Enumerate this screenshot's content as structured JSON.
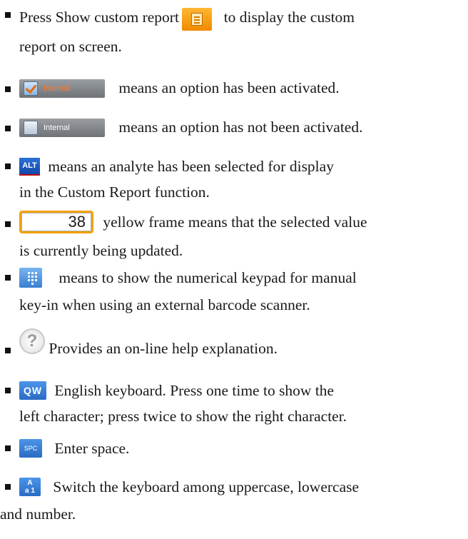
{
  "items": [
    {
      "icon": "report-icon",
      "before": "Press Show custom report",
      "after": "to display the custom",
      "cont": "report on screen."
    },
    {
      "icon": "checkbox-checked-icon",
      "chip_label": "Internal",
      "text": "means an option has been activated."
    },
    {
      "icon": "checkbox-unchecked-icon",
      "chip_label": "Internal",
      "text": "means an option has not been activated."
    },
    {
      "icon": "alt-badge-icon",
      "badge_label": "ALT",
      "text": "means an analyte has been selected for display",
      "cont": "in the Custom Report function."
    },
    {
      "icon": "value-field-icon",
      "value": "38",
      "text": "yellow frame means that the selected value",
      "cont": "is currently being updated."
    },
    {
      "icon": "keypad-icon",
      "text": "means to show the numerical keypad for manual",
      "cont": "key-in when using an external barcode scanner."
    },
    {
      "icon": "help-icon",
      "glyph": "?",
      "text": "Provides an on-line help explanation."
    },
    {
      "icon": "qw-key-icon",
      "key_label": "QW",
      "text": "English keyboard. Press one time to show the",
      "cont": "left character; press twice to show the right character."
    },
    {
      "icon": "spc-key-icon",
      "key_label": "SPC",
      "text": "Enter space."
    },
    {
      "icon": "case-key-icon",
      "key_top": "A",
      "key_bottom": "a 1",
      "text": "Switch the keyboard among uppercase, lowercase",
      "cont": "and number."
    }
  ]
}
